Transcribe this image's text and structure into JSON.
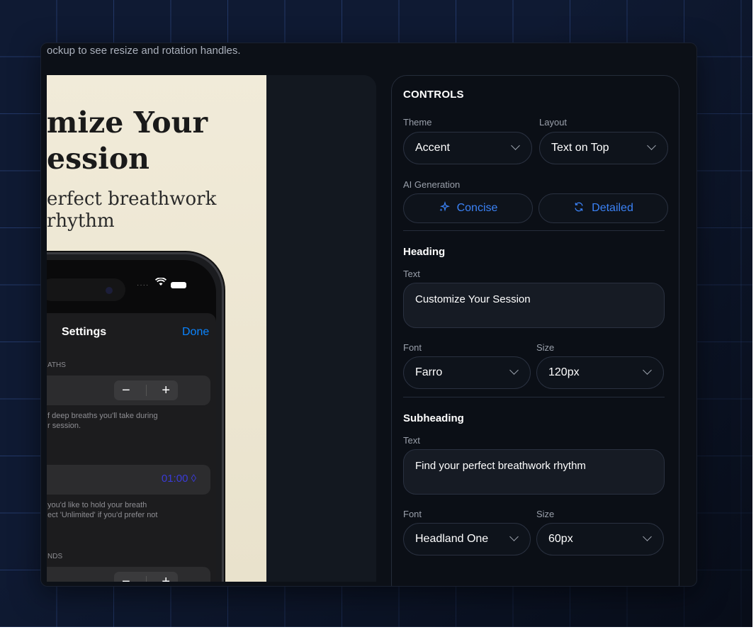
{
  "hint_text": "ockup to see resize and rotation handles.",
  "preview": {
    "heading": "mize Your ession",
    "heading_line1": "mize Your",
    "heading_line2": "ession",
    "subheading_line1": "erfect breathwork",
    "subheading_line2": "rhythm",
    "phone": {
      "sheet_title": "Settings",
      "done_label": "Done",
      "section1_label": "ATHS",
      "section1_desc_line1": "f deep breaths you'll take during",
      "section1_desc_line2": "r session.",
      "hold_value": "01:00 ◊",
      "section2_desc_line1": "you'd like to hold your breath",
      "section2_desc_line2": "ect 'Unlimited' if you'd prefer not",
      "section3_label": "NDS",
      "minus": "−",
      "plus": "+"
    }
  },
  "controls": {
    "title": "CONTROLS",
    "theme_label": "Theme",
    "theme_value": "Accent",
    "layout_label": "Layout",
    "layout_value": "Text on Top",
    "ai_label": "AI Generation",
    "concise_label": "Concise",
    "detailed_label": "Detailed",
    "heading_section": "Heading",
    "heading_text_label": "Text",
    "heading_text_value": "Customize Your Session",
    "heading_font_label": "Font",
    "heading_font_value": "Farro",
    "heading_size_label": "Size",
    "heading_size_value": "120px",
    "subheading_section": "Subheading",
    "subheading_text_label": "Text",
    "subheading_text_value": "Find your perfect breathwork rhythm",
    "subheading_font_label": "Font",
    "subheading_font_value": "Headland One",
    "subheading_size_label": "Size",
    "subheading_size_value": "60px"
  },
  "colors": {
    "accent": "#3b82f6",
    "panel_bg": "#0b0f16",
    "canvas_bg": "#f1ebd9",
    "grid_line": "#2f4a8a"
  },
  "icons": {
    "concise": "sparkles-icon",
    "detailed": "refresh-icon",
    "chevron": "chevron-down-icon"
  }
}
